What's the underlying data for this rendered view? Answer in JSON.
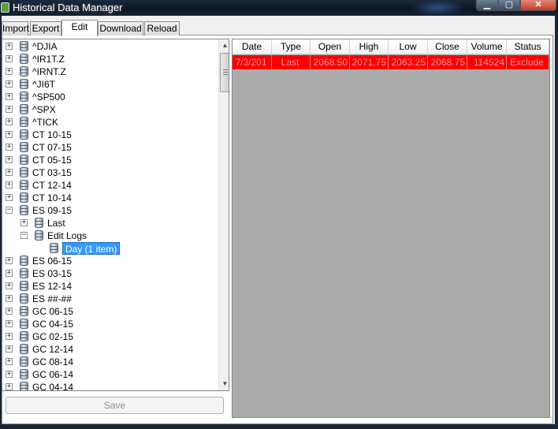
{
  "window": {
    "title": "Historical Data Manager",
    "controls": {
      "minimize": "▁",
      "maximize": "▢",
      "close": "✕"
    }
  },
  "tabs": [
    {
      "label": "Import"
    },
    {
      "label": "Export"
    },
    {
      "label": "Edit",
      "active": true
    },
    {
      "label": "Download"
    },
    {
      "label": "Reload"
    }
  ],
  "tree": {
    "nodes": [
      {
        "label": "^DJIA",
        "expander": "+"
      },
      {
        "label": "^IR1T.Z",
        "expander": "+"
      },
      {
        "label": "^IRNT.Z",
        "expander": "+"
      },
      {
        "label": "^JI6T",
        "expander": "+"
      },
      {
        "label": "^SP500",
        "expander": "+"
      },
      {
        "label": "^SPX",
        "expander": "+"
      },
      {
        "label": "^TICK",
        "expander": "+"
      },
      {
        "label": "CT 10-15",
        "expander": "+"
      },
      {
        "label": "CT 07-15",
        "expander": "+"
      },
      {
        "label": "CT 05-15",
        "expander": "+"
      },
      {
        "label": "CT 03-15",
        "expander": "+"
      },
      {
        "label": "CT 12-14",
        "expander": "+"
      },
      {
        "label": "CT 10-14",
        "expander": "+"
      },
      {
        "label": "ES 09-15",
        "expander": "−"
      },
      {
        "label": "Last",
        "expander": "+",
        "level": 1
      },
      {
        "label": "Edit Logs",
        "expander": "−",
        "level": 1
      },
      {
        "label": "Day (1 item)",
        "expander": "",
        "level": 2,
        "selected": true
      },
      {
        "label": "ES 06-15",
        "expander": "+"
      },
      {
        "label": "ES 03-15",
        "expander": "+"
      },
      {
        "label": "ES 12-14",
        "expander": "+"
      },
      {
        "label": "ES ##-##",
        "expander": "+"
      },
      {
        "label": "GC 06-15",
        "expander": "+"
      },
      {
        "label": "GC 04-15",
        "expander": "+"
      },
      {
        "label": "GC 02-15",
        "expander": "+"
      },
      {
        "label": "GC 12-14",
        "expander": "+"
      },
      {
        "label": "GC 08-14",
        "expander": "+"
      },
      {
        "label": "GC 06-14",
        "expander": "+"
      },
      {
        "label": "GC 04-14",
        "expander": "+"
      }
    ],
    "scroll": {
      "up": "▲",
      "down": "▼",
      "position": 0.0
    }
  },
  "save_button": {
    "label": "Save"
  },
  "grid": {
    "columns": [
      "Date",
      "Type",
      "Open",
      "High",
      "Low",
      "Close",
      "Volume",
      "Status"
    ],
    "rows": [
      {
        "date": "7/3/201",
        "type": "Last",
        "open": "2068.50",
        "high": "2071.75",
        "low": "2063.25",
        "close": "2068.75",
        "volume": "114524",
        "status": "Exclude"
      }
    ],
    "row_color": "#ff0000"
  }
}
